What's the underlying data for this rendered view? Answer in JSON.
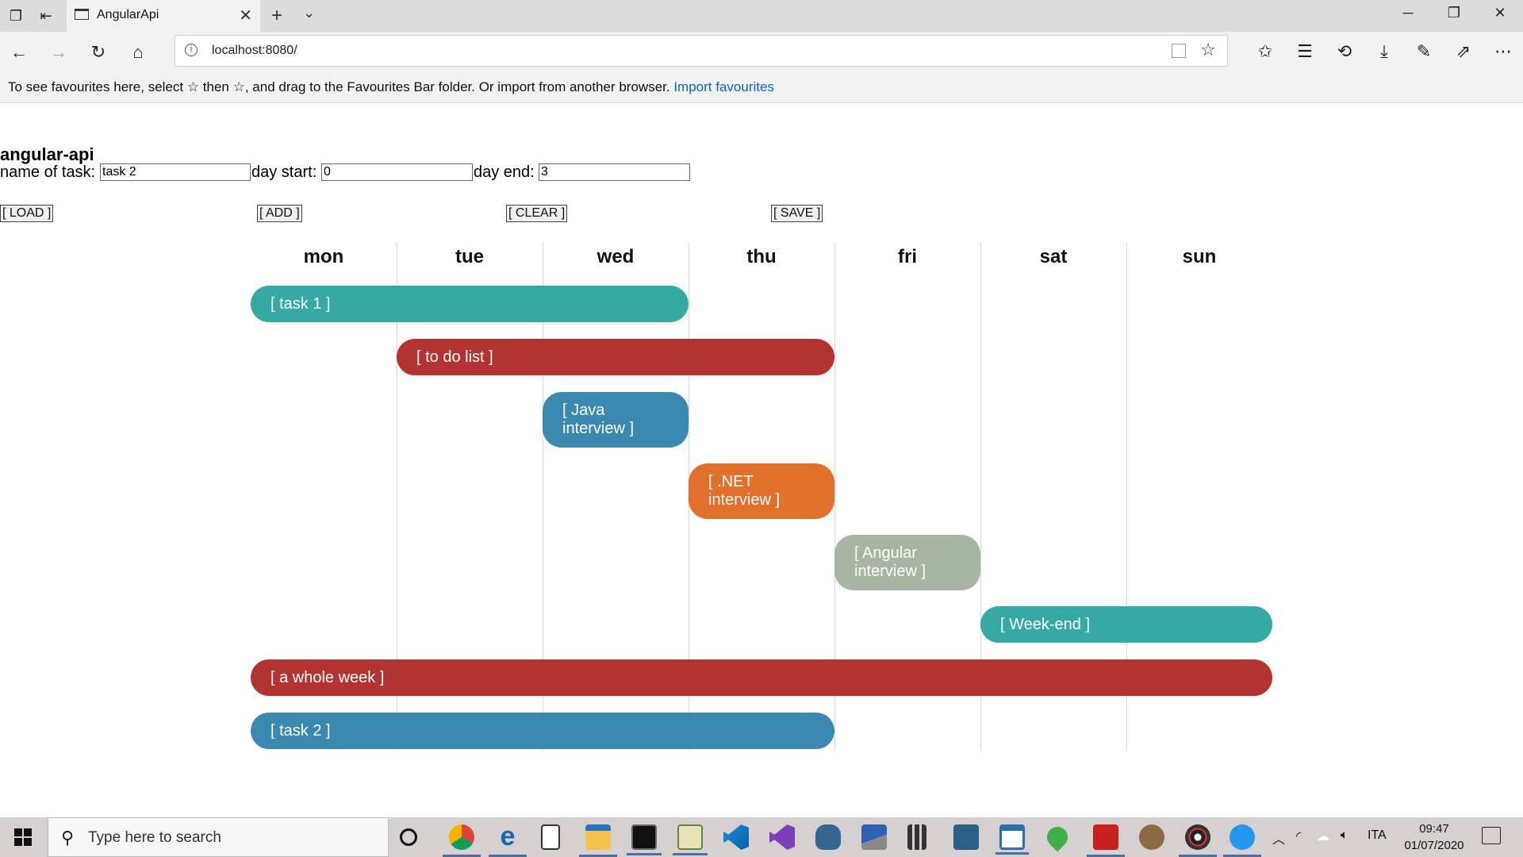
{
  "browser": {
    "tab_title": "AngularApi",
    "url": "localhost:8080/",
    "favourites_message": "To see favourites here, select  ☆ then ☆, and drag to the Favourites Bar folder. Or import from another browser. ",
    "favourites_link": "Import favourites"
  },
  "app": {
    "title": "angular-api",
    "form": {
      "task_label": "name of task:",
      "task_value": "task 2",
      "start_label": "day start:",
      "start_value": "0",
      "end_label": "day end:",
      "end_value": "3"
    },
    "buttons": {
      "load": "[ LOAD ]",
      "add": "[ ADD ]",
      "clear": "[ CLEAR ]",
      "save": "[ SAVE ]"
    },
    "days": [
      "mon",
      "tue",
      "wed",
      "thu",
      "fri",
      "sat",
      "sun"
    ],
    "tasks": [
      {
        "label": "[ task 1 ]",
        "day_start": 0,
        "day_end": 2,
        "color": "#36a9a5",
        "lines": 1
      },
      {
        "label": "[ to do list ]",
        "day_start": 1,
        "day_end": 3,
        "color": "#b33333",
        "lines": 1
      },
      {
        "label": "[ Java interview ]",
        "day_start": 2,
        "day_end": 2,
        "color": "#3b88b0",
        "lines": 2
      },
      {
        "label": "[ .NET interview ]",
        "day_start": 3,
        "day_end": 3,
        "color": "#e0702c",
        "lines": 2
      },
      {
        "label": "[ Angular interview ]",
        "day_start": 4,
        "day_end": 4,
        "color": "#a8b5a2",
        "lines": 2
      },
      {
        "label": "[ Week-end ]",
        "day_start": 5,
        "day_end": 6,
        "color": "#36a9a5",
        "lines": 1
      },
      {
        "label": "[ a whole week ]",
        "day_start": 0,
        "day_end": 6,
        "color": "#b33333",
        "lines": 1
      },
      {
        "label": "[ task 2 ]",
        "day_start": 0,
        "day_end": 3,
        "color": "#3b88b0",
        "lines": 1
      }
    ]
  },
  "taskbar": {
    "search_placeholder": "Type here to search",
    "language": "ITA",
    "time": "09:47",
    "date": "01/07/2020"
  }
}
